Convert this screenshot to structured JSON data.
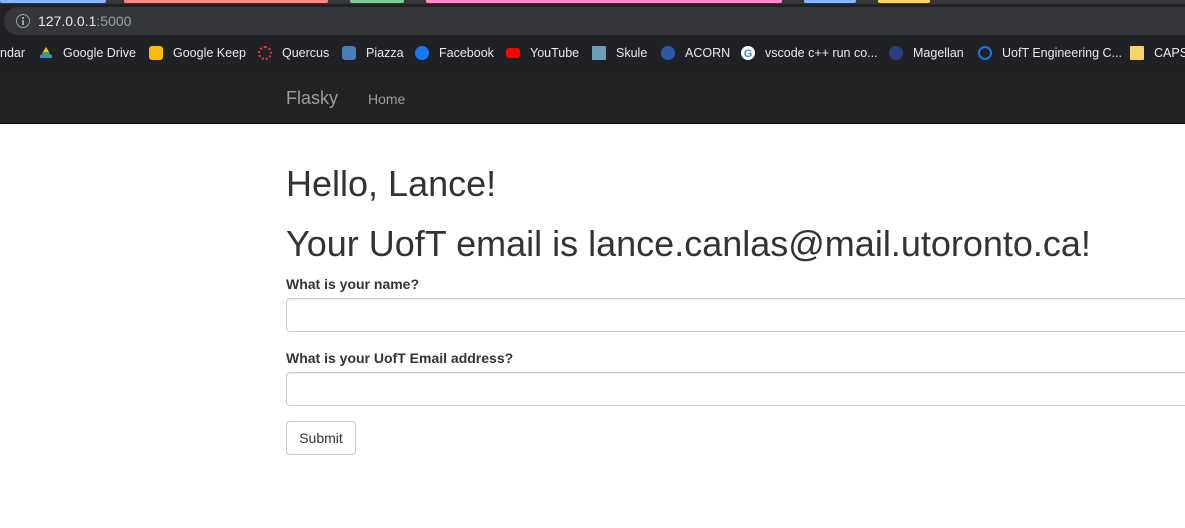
{
  "browser": {
    "url_host": "127.0.0.1",
    "url_port": ":5000",
    "tab_colors": [
      "#8ab4f8",
      "#f28b82",
      "#81c995",
      "#ff8bcb",
      "#8ab4f8",
      "#fdd663"
    ],
    "bookmarks": [
      {
        "label": "ndar",
        "icon": "calendar-icon",
        "color": ""
      },
      {
        "label": "Google Drive",
        "icon": "google-drive-icon",
        "color": "#34a853"
      },
      {
        "label": "Google Keep",
        "icon": "google-keep-icon",
        "color": "#fbbc04"
      },
      {
        "label": "Quercus",
        "icon": "quercus-icon",
        "color": "#e53935"
      },
      {
        "label": "Piazza",
        "icon": "piazza-icon",
        "color": "#4a7dbc"
      },
      {
        "label": "Facebook",
        "icon": "facebook-icon",
        "color": "#1877f2"
      },
      {
        "label": "YouTube",
        "icon": "youtube-icon",
        "color": "#ff0000"
      },
      {
        "label": "Skule",
        "icon": "skule-icon",
        "color": "#6a9fb5"
      },
      {
        "label": "ACORN",
        "icon": "acorn-icon",
        "color": "#2d5aa8"
      },
      {
        "label": "vscode c++ run co...",
        "icon": "google-icon",
        "color": "#ffffff"
      },
      {
        "label": "Magellan",
        "icon": "magellan-icon",
        "color": "#2b3d7a"
      },
      {
        "label": "UofT Engineering C...",
        "icon": "uoft-engineering-icon",
        "color": "#1a73e8"
      },
      {
        "label": "CAPST",
        "icon": "folder-icon",
        "color": "#f6d365"
      }
    ]
  },
  "navbar": {
    "brand": "Flasky",
    "home": "Home"
  },
  "main": {
    "greeting": "Hello, Lance!",
    "email_line": "Your UofT email is lance.canlas@mail.utoronto.ca!",
    "form": {
      "name_label": "What is your name?",
      "name_value": "",
      "email_label": "What is your UofT Email address?",
      "email_value": "",
      "submit_label": "Submit"
    }
  }
}
